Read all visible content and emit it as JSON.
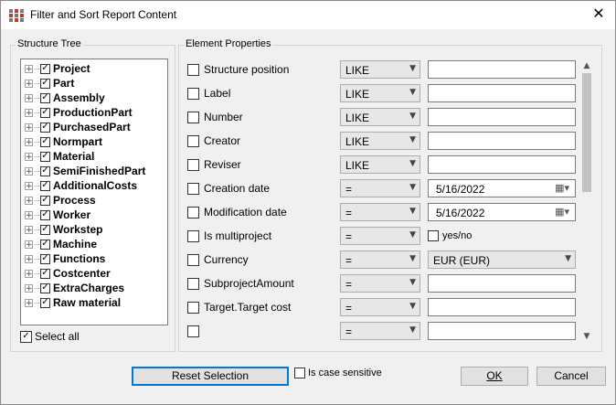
{
  "window": {
    "title": "Filter and Sort Report Content",
    "close_glyph": "✕"
  },
  "structure_tree": {
    "legend": "Structure Tree",
    "items": [
      {
        "label": "Project",
        "checked": true
      },
      {
        "label": "Part",
        "checked": true
      },
      {
        "label": "Assembly",
        "checked": true
      },
      {
        "label": "ProductionPart",
        "checked": true
      },
      {
        "label": "PurchasedPart",
        "checked": true
      },
      {
        "label": "Normpart",
        "checked": true
      },
      {
        "label": "Material",
        "checked": true
      },
      {
        "label": "SemiFinishedPart",
        "checked": true
      },
      {
        "label": "AdditionalCosts",
        "checked": true
      },
      {
        "label": "Process",
        "checked": true
      },
      {
        "label": "Worker",
        "checked": true
      },
      {
        "label": "Workstep",
        "checked": true
      },
      {
        "label": "Machine",
        "checked": true
      },
      {
        "label": "Functions",
        "checked": true
      },
      {
        "label": "Costcenter",
        "checked": true
      },
      {
        "label": "ExtraCharges",
        "checked": true
      },
      {
        "label": "Raw material",
        "checked": true
      }
    ],
    "select_all_label": "Select all",
    "select_all_checked": true
  },
  "element_properties": {
    "legend": "Element Properties",
    "rows": [
      {
        "label": "Structure position",
        "operator": "LIKE",
        "value_type": "text",
        "value": ""
      },
      {
        "label": "Label",
        "operator": "LIKE",
        "value_type": "text",
        "value": ""
      },
      {
        "label": "Number",
        "operator": "LIKE",
        "value_type": "text",
        "value": ""
      },
      {
        "label": "Creator",
        "operator": "LIKE",
        "value_type": "text",
        "value": ""
      },
      {
        "label": "Reviser",
        "operator": "LIKE",
        "value_type": "text",
        "value": ""
      },
      {
        "label": "Creation date",
        "operator": "=",
        "value_type": "date",
        "value": "5/16/2022"
      },
      {
        "label": "Modification date",
        "operator": "=",
        "value_type": "date",
        "value": "5/16/2022"
      },
      {
        "label": "Is multiproject",
        "operator": "=",
        "value_type": "bool",
        "value": "yes/no"
      },
      {
        "label": "Currency",
        "operator": "=",
        "value_type": "select",
        "value": "EUR (EUR)"
      },
      {
        "label": "SubprojectAmount",
        "operator": "=",
        "value_type": "text",
        "value": ""
      },
      {
        "label": "Target.Target cost",
        "operator": "=",
        "value_type": "text",
        "value": ""
      },
      {
        "label": "",
        "operator": "=",
        "value_type": "text",
        "value": ""
      }
    ]
  },
  "footer": {
    "reset_label": "Reset Selection",
    "case_sensitive_label": "Is case sensitive",
    "case_sensitive_checked": false,
    "ok_label": "OK",
    "cancel_label": "Cancel"
  }
}
